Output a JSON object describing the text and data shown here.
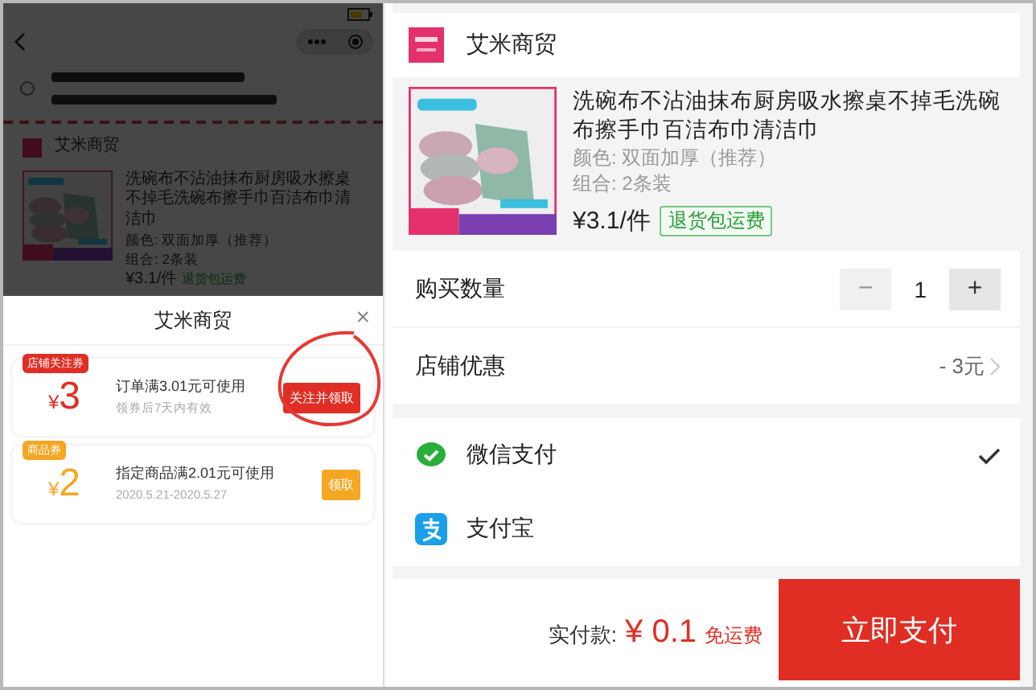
{
  "background_page": {
    "shop": {
      "name": "艾米商贸"
    },
    "product": {
      "title": "洗碗布不沾油抹布厨房吸水擦桌不掉毛洗碗布擦手巾百洁布巾清洁巾",
      "options": [
        "颜色: 双面加厚（推荐）",
        "组合: 2条装"
      ],
      "price": "¥3.1/件",
      "tag": "退货包运费"
    }
  },
  "coupon_sheet": {
    "title": "艾米商贸",
    "close": "×",
    "coupons": [
      {
        "tag": "店铺关注券",
        "currency": "¥",
        "amount": "3",
        "condition": "订单满3.01元可使用",
        "validity": "领券后7天内有效",
        "button": "关注并领取",
        "color": "#e02e24",
        "circled": true
      },
      {
        "tag": "商品券",
        "currency": "¥",
        "amount": "2",
        "condition": "指定商品满2.01元可使用",
        "validity": "2020.5.21-2020.5.27",
        "button": "领取",
        "color": "#f5a623",
        "circled": false
      }
    ]
  },
  "checkout": {
    "shop": {
      "name": "艾米商贸"
    },
    "product": {
      "title": "洗碗布不沾油抹布厨房吸水擦桌不掉毛洗碗布擦手巾百洁布巾清洁巾",
      "options": [
        "颜色: 双面加厚（推荐）",
        "组合: 2条装"
      ],
      "price": "¥3.1/件",
      "tag": "退货包运费"
    },
    "quantity": {
      "label": "购买数量",
      "minus": "−",
      "value": "1",
      "plus": "+",
      "minus_disabled": true
    },
    "discount": {
      "label": "店铺优惠",
      "value": "- 3元"
    },
    "payments": [
      {
        "kind": "wechat",
        "label": "微信支付",
        "selected": true
      },
      {
        "kind": "alipay",
        "label": "支付宝",
        "selected": false
      }
    ],
    "footer": {
      "label": "实付款:",
      "amount": "¥ 0.1",
      "note": "免运费",
      "button": "立即支付"
    }
  }
}
